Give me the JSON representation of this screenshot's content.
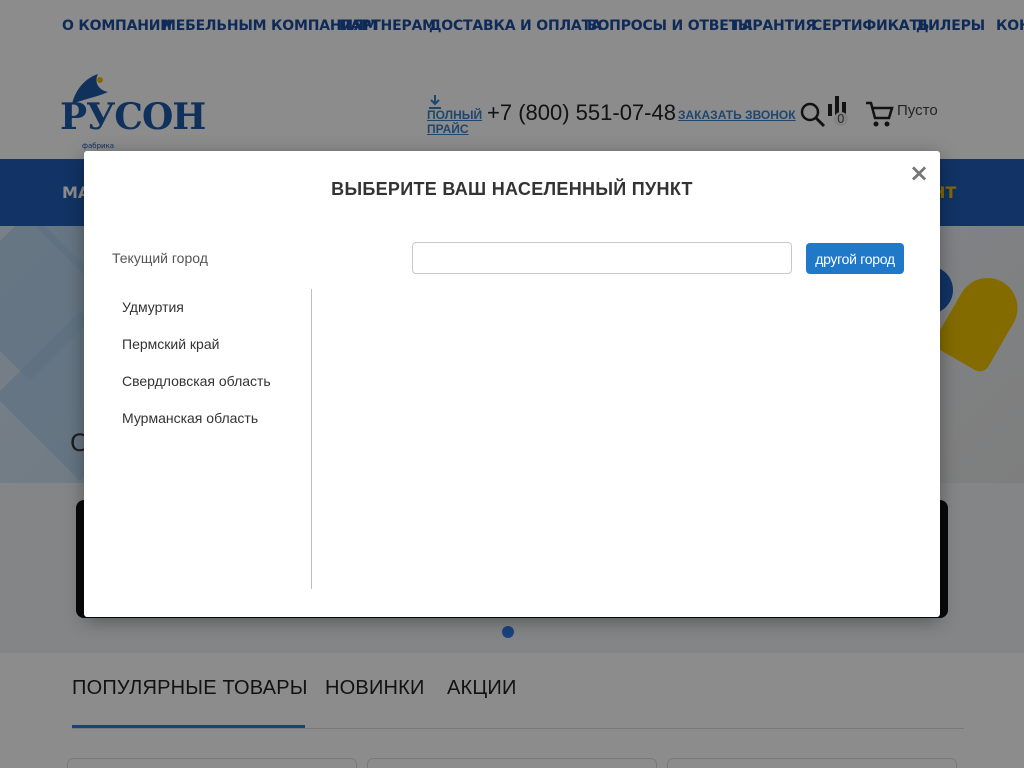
{
  "topnav": {
    "items": [
      "О КОМПАНИИ",
      "МЕБЕЛЬНЫМ КОМПАНИЯМ",
      "ПАРТНЕРАМ",
      "ДОСТАВКА И ОПЛАТА",
      "ВОПРОСЫ И ОТВЕТЫ",
      "ГАРАНТИЯ",
      "СЕРТИФИКАТЫ",
      "ДИЛЕРЫ",
      "КОН"
    ]
  },
  "header": {
    "logo_text": "РУСОН",
    "logo_sub": "фабрика",
    "price_link": "ПОЛНЫЙ ПРАЙС",
    "phone": "+7 (800) 551-07-48",
    "callback": "ЗАКАЗАТЬ ЗВОНОК",
    "compare_count": "0",
    "cart_label": "Пусто"
  },
  "mainnav": {
    "left": "МА",
    "right": "НТ"
  },
  "hero": {
    "text": "С"
  },
  "tabs": [
    "ПОПУЛЯРНЫЕ ТОВАРЫ",
    "НОВИНКИ",
    "АКЦИИ"
  ],
  "modal": {
    "title": "ВЫБЕРИТЕ ВАШ НАСЕЛЕННЫЙ ПУНКТ",
    "close": "×",
    "current_label": "Текущий город",
    "input_value": "",
    "input_placeholder": "",
    "other_button": "другой город",
    "regions": [
      "Удмуртия",
      "Пермский край",
      "Свердловская область",
      "Мурманская область"
    ]
  },
  "colors": {
    "brand_blue": "#1f5db8",
    "accent_yellow": "#f3c000",
    "button_blue": "#1f78c8",
    "link_blue": "#3a82c8"
  }
}
